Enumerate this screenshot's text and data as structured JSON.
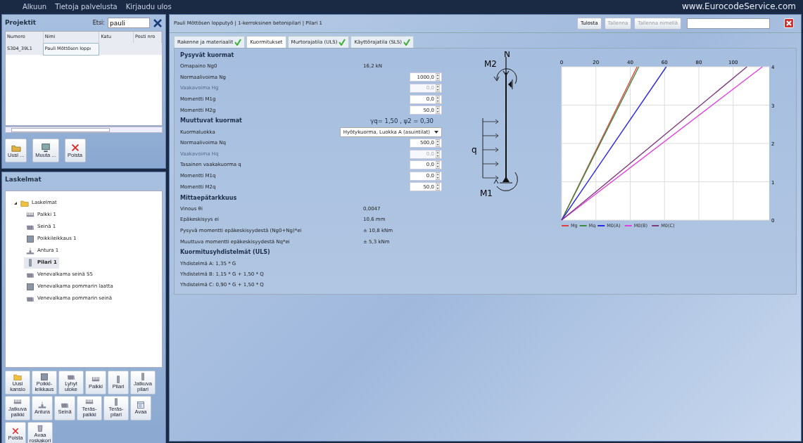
{
  "menu": [
    "Alkuun",
    "Tietoja palvelusta",
    "Kirjaudu ulos"
  ],
  "site": "www.EurocodeService.com",
  "projects": {
    "title": "Projektit",
    "search_label": "Etsi:",
    "search_value": "pauli",
    "columns": [
      "Numero",
      "Nimi",
      "Katu",
      "Posti nro"
    ],
    "rows": [
      {
        "cells": [
          "S304_39L1",
          "Pauli Möttösen loppı",
          "",
          ""
        ],
        "selected": true
      }
    ],
    "buttons": [
      {
        "label": "Uusi ...",
        "kind": "new"
      },
      {
        "label": "Muuta ...",
        "kind": "edit"
      },
      {
        "label": "Poista",
        "kind": "delete"
      }
    ]
  },
  "calculations": {
    "title": "Laskelmat",
    "tree": [
      {
        "label": "Laskelmat",
        "kind": "folder",
        "expanded": true,
        "selected": false,
        "children": [
          {
            "label": "Palkki 1",
            "kind": "beam",
            "selected": false
          },
          {
            "label": "Seinä 1",
            "kind": "wall",
            "selected": false
          },
          {
            "label": "Poikkileikkaus 1",
            "kind": "section",
            "selected": false
          },
          {
            "label": "Antura 1",
            "kind": "footing",
            "selected": false
          },
          {
            "label": "Pilari  1",
            "kind": "column",
            "selected": true
          },
          {
            "label": "Venevalkama seinä S5",
            "kind": "wall",
            "selected": false
          },
          {
            "label": "Venevalkama pommarin laatta",
            "kind": "section",
            "selected": false
          },
          {
            "label": "Venevalkama pommarin seinä",
            "kind": "wall",
            "selected": false
          }
        ]
      }
    ],
    "buttons": [
      {
        "label": "Uusi kansio",
        "kind": "folder"
      },
      {
        "label": "Poikki-leikkaus",
        "kind": "section"
      },
      {
        "label": "Lyhyt uloke",
        "kind": "wall"
      },
      {
        "label": "Palkki",
        "kind": "beam"
      },
      {
        "label": "Pilari",
        "kind": "column"
      },
      {
        "label": "Jatkuva pilari",
        "kind": "column"
      },
      {
        "label": "Jatkuva palkki",
        "kind": "beam"
      },
      {
        "label": "Antura",
        "kind": "footing"
      },
      {
        "label": "Seinä",
        "kind": "wall"
      },
      {
        "label": "Teräs-palkki",
        "kind": "beam"
      },
      {
        "label": "Teräs-pilari",
        "kind": "column"
      },
      {
        "label": "Avaa",
        "kind": "open"
      },
      {
        "label": "Poista",
        "kind": "delete"
      },
      {
        "label": "Avaa roskakori",
        "kind": "bin"
      }
    ]
  },
  "breadcrumb": "Pauli Möttösen lopputyö | 1-kerroksinen betonipilari | Pilari  1",
  "actions": [
    {
      "label": "Tulosta",
      "disabled": false
    },
    {
      "label": "Tallenna",
      "disabled": true
    },
    {
      "label": "Tallenna nimellä",
      "disabled": true
    }
  ],
  "tabs": [
    {
      "label": "Rakenne ja materiaalit",
      "checked": true,
      "selected": false
    },
    {
      "label": "Kuormitukset",
      "checked": false,
      "selected": true
    },
    {
      "label": "Murtorajatila (ULS)",
      "checked": true,
      "selected": false
    },
    {
      "label": "Käyttörajatila (SLS)",
      "checked": true,
      "selected": false
    }
  ],
  "form": [
    {
      "kind": "heading",
      "label": "Pysyvät kuormat"
    },
    {
      "kind": "text",
      "label": "Omapaino Ng0",
      "value": "16,2 kN"
    },
    {
      "kind": "input",
      "label": "Normaalivoima Ng",
      "value": "1000,0",
      "disabled": false
    },
    {
      "kind": "input",
      "label": "Vaakavoima Hg",
      "value": "0,0",
      "disabled": true
    },
    {
      "kind": "input",
      "label": "Momentti M1g",
      "value": "0,0",
      "disabled": false
    },
    {
      "kind": "input",
      "label": "Momentti M2g",
      "value": "50,0",
      "disabled": false
    },
    {
      "kind": "heading",
      "label": "Muuttuvat kuormat",
      "value": "γq=  1,50  , ψ2 =  0,30"
    },
    {
      "kind": "select",
      "label": "Kuormaluokka",
      "value": "Hyötykuorma, Luokka A (asuintilat)"
    },
    {
      "kind": "input",
      "label": "Normaalivoima Nq",
      "value": "500,0",
      "disabled": false
    },
    {
      "kind": "input",
      "label": "Vaakavoima Hq",
      "value": "0,0",
      "disabled": true
    },
    {
      "kind": "input",
      "label": "Tasainen vaakakuorma q",
      "value": "0,0",
      "disabled": false
    },
    {
      "kind": "input",
      "label": "Momentti M1q",
      "value": "0,0",
      "disabled": false
    },
    {
      "kind": "input",
      "label": "Momentti M2q",
      "value": "50,0",
      "disabled": false
    },
    {
      "kind": "heading",
      "label": "Mittaepätarkkuus"
    },
    {
      "kind": "text",
      "label": "Vinous θi",
      "value": "0,0047"
    },
    {
      "kind": "text",
      "label": "Epäkeskisyys ei",
      "value": "10,6 mm"
    },
    {
      "kind": "text",
      "label": "Pysyvä momentti epäkeskisyydestä (Ng0+Ng)*ei",
      "value": "± 10,8 kNm"
    },
    {
      "kind": "text",
      "label": "Muuttuva momentti epäkeskisyydestä Nq*ei",
      "value": "± 5,3 kNm"
    },
    {
      "kind": "heading",
      "label": "Kuormitusyhdistelmät (ULS)"
    },
    {
      "kind": "combo",
      "label": "Yhdistelmä A:  1,35 * G"
    },
    {
      "kind": "combo",
      "label": "Yhdistelmä B:  1,15 * G + 1,50 * Q"
    },
    {
      "kind": "combo",
      "label": "Yhdistelmä C:  0,90 * G + 1,50 * Q"
    }
  ],
  "diagram_labels": [
    "N",
    "M2",
    "q",
    "M1"
  ],
  "chart": {
    "chart_data": {
      "type": "line",
      "orientation": "horizontal",
      "x": [
        0,
        4
      ],
      "ylim": [
        0,
        4
      ],
      "xlim": [
        0,
        121
      ],
      "grid": true,
      "legend": "bottom",
      "yticks": [
        0,
        1,
        2,
        3,
        4
      ],
      "xticks": [
        0,
        20,
        40,
        60,
        80,
        100
      ],
      "series": [
        {
          "name": "Mg",
          "color": "#e04040",
          "values": [
            0,
            44
          ]
        },
        {
          "name": "Mq",
          "color": "#3a8a3a",
          "values": [
            0,
            45
          ]
        },
        {
          "name": "M0(A)",
          "color": "#2a2ae0",
          "values": [
            0,
            61
          ]
        },
        {
          "name": "M0(B)",
          "color": "#e040e0",
          "values": [
            0,
            117
          ]
        },
        {
          "name": "M0(C)",
          "color": "#803a80",
          "values": [
            0,
            108
          ]
        }
      ]
    }
  }
}
